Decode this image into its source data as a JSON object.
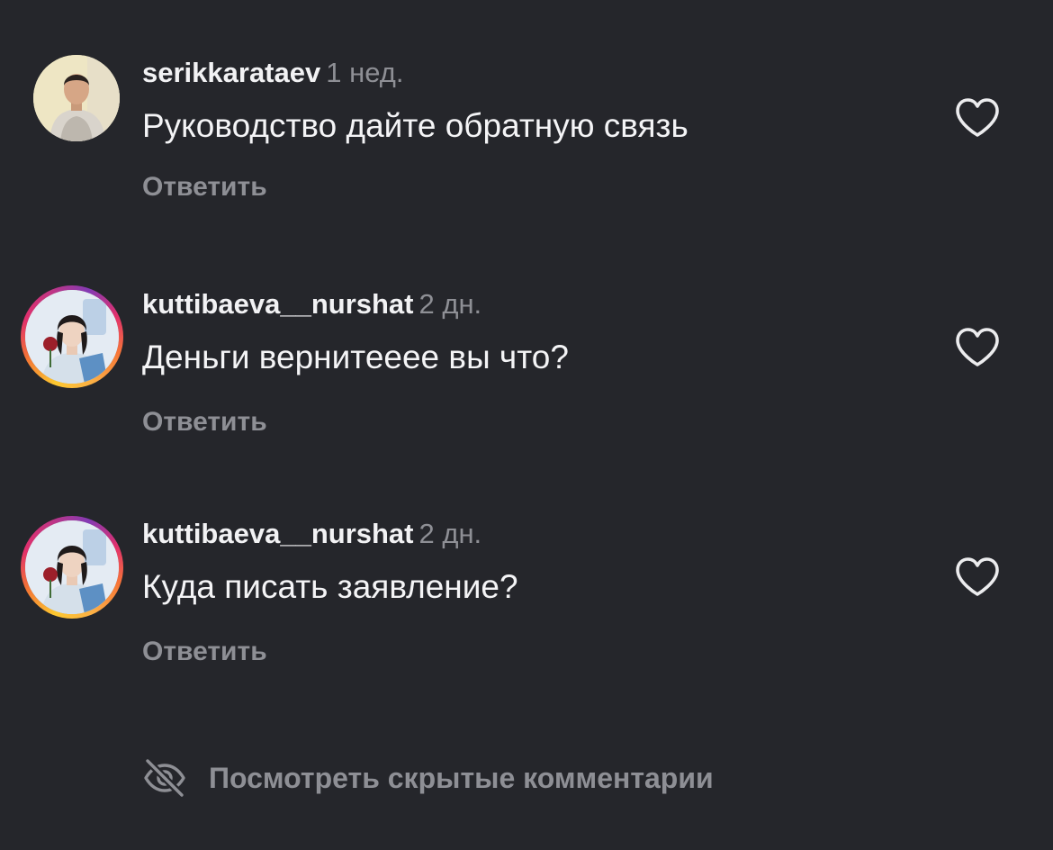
{
  "comments": [
    {
      "username": "serikkarataev",
      "time": "1 нед.",
      "text": "Руководство дайте обратную связь",
      "reply_label": "Ответить",
      "avatar_style": "plain",
      "like_icon": "heart-outline-icon"
    },
    {
      "username": "kuttibaeva__nurshat",
      "time": "2 дн.",
      "text": "Деньги вернитееее вы что?",
      "reply_label": "Ответить",
      "avatar_style": "story-ring",
      "like_icon": "heart-outline-icon"
    },
    {
      "username": "kuttibaeva__nurshat",
      "time": "2 дн.",
      "text": "Куда писать заявление?",
      "reply_label": "Ответить",
      "avatar_style": "story-ring",
      "like_icon": "heart-outline-icon"
    }
  ],
  "hidden_comments": {
    "label": "Посмотреть скрытые комментарии",
    "icon": "eye-slash-icon"
  },
  "colors": {
    "background": "#25262b",
    "primary_text": "#f2f2f4",
    "secondary_text": "#8e8f95"
  }
}
